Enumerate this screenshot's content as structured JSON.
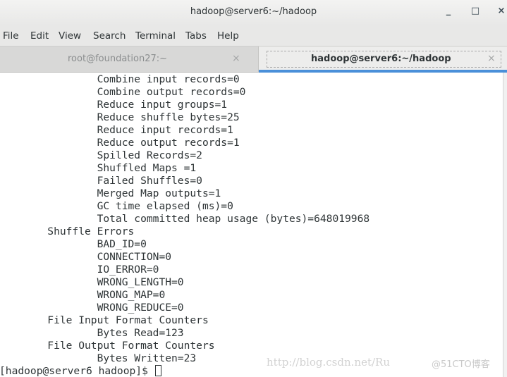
{
  "window": {
    "title": "hadoop@server6:~/hadoop",
    "controls": {
      "minimize": "_",
      "maximize": "□",
      "close": "×"
    }
  },
  "menubar": {
    "items": [
      "File",
      "Edit",
      "View",
      "Search",
      "Terminal",
      "Tabs",
      "Help"
    ]
  },
  "tabs": [
    {
      "label": "root@foundation27:~",
      "active": false,
      "close": "×"
    },
    {
      "label": "hadoop@server6:~/hadoop",
      "active": true,
      "close": "×"
    }
  ],
  "terminal": {
    "lines": [
      "                Combine input records=0",
      "                Combine output records=0",
      "                Reduce input groups=1",
      "                Reduce shuffle bytes=25",
      "                Reduce input records=1",
      "                Reduce output records=1",
      "                Spilled Records=2",
      "                Shuffled Maps =1",
      "                Failed Shuffles=0",
      "                Merged Map outputs=1",
      "                GC time elapsed (ms)=0",
      "                Total committed heap usage (bytes)=648019968",
      "        Shuffle Errors",
      "                BAD_ID=0",
      "                CONNECTION=0",
      "                IO_ERROR=0",
      "                WRONG_LENGTH=0",
      "                WRONG_MAP=0",
      "                WRONG_REDUCE=0",
      "        File Input Format Counters",
      "                Bytes Read=123",
      "        File Output Format Counters",
      "                Bytes Written=23"
    ],
    "prompt": "[hadoop@server6 hadoop]$ "
  },
  "watermark": {
    "url": "http://blog.csdn.net/Ru",
    "site": "@51CTO博客"
  }
}
